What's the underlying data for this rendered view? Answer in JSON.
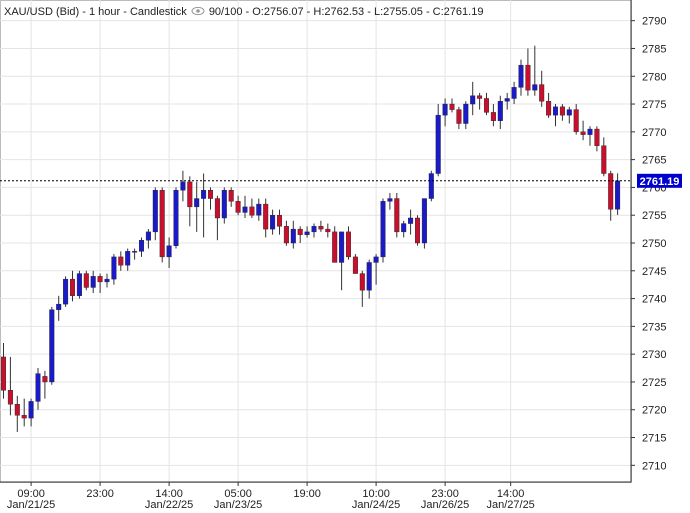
{
  "header": {
    "symbol": "XAU/USD (Bid)",
    "sep1": " - ",
    "interval": "1 hour",
    "sep2": " - ",
    "style": "Candlestick",
    "count": "90/100",
    "open": "O:2756.07",
    "high": "H:2762.53",
    "low": "L:2755.05",
    "close": "C:2761.19"
  },
  "colors": {
    "up": "#1a1ac8",
    "down": "#c8102e",
    "grid": "#e4e4e4",
    "axis": "#333333",
    "price_tag": "#0000cc"
  },
  "icons": {
    "visibility": "eye-icon"
  },
  "chart_data": {
    "type": "candlestick",
    "title": "XAU/USD (Bid) - 1 hour - Candlestick",
    "ylim": [
      2707,
      2793
    ],
    "yticks": [
      2710,
      2715,
      2720,
      2725,
      2730,
      2735,
      2740,
      2745,
      2750,
      2755,
      2760,
      2765,
      2770,
      2775,
      2780,
      2785,
      2790
    ],
    "grid": true,
    "current_price": 2761.19,
    "current_price_label": "2761.19",
    "xticks": [
      {
        "i": 4,
        "label": "09:00",
        "date": "Jan/21/25"
      },
      {
        "i": 14,
        "label": "23:00",
        "date": ""
      },
      {
        "i": 24,
        "label": "14:00",
        "date": "Jan/22/25"
      },
      {
        "i": 34,
        "label": "05:00",
        "date": "Jan/23/25"
      },
      {
        "i": 44,
        "label": "19:00",
        "date": ""
      },
      {
        "i": 54,
        "label": "10:00",
        "date": "Jan/24/25"
      },
      {
        "i": 64,
        "label": "23:00",
        "date": "Jan/26/25"
      },
      {
        "i": 73.5,
        "label": "14:00",
        "date": "Jan/27/25"
      }
    ],
    "ohlc": [
      [
        2729.5,
        2732,
        2722,
        2723.5
      ],
      [
        2723.5,
        2729.5,
        2719,
        2721
      ],
      [
        2721,
        2722.5,
        2716,
        2719
      ],
      [
        2719,
        2722,
        2717,
        2718.5
      ],
      [
        2718.5,
        2722,
        2717,
        2721.5
      ],
      [
        2721.5,
        2727.5,
        2720,
        2726.5
      ],
      [
        2726,
        2727,
        2722,
        2725
      ],
      [
        2725,
        2738.5,
        2724.5,
        2738
      ],
      [
        2738,
        2740.5,
        2736,
        2739
      ],
      [
        2739,
        2744,
        2738.5,
        2743.5
      ],
      [
        2743.5,
        2745,
        2739.5,
        2740.5
      ],
      [
        2740.5,
        2745,
        2740,
        2744.5
      ],
      [
        2744.5,
        2745,
        2741.5,
        2742
      ],
      [
        2742,
        2745,
        2741,
        2744
      ],
      [
        2744,
        2744.5,
        2741,
        2743
      ],
      [
        2743,
        2744.5,
        2742,
        2743.5
      ],
      [
        2743.5,
        2748,
        2742.5,
        2747.5
      ],
      [
        2747.5,
        2748.5,
        2745,
        2746
      ],
      [
        2746,
        2749,
        2745,
        2748.5
      ],
      [
        2748.5,
        2749,
        2747,
        2748.5
      ],
      [
        2748.5,
        2751,
        2747.5,
        2750.5
      ],
      [
        2750.5,
        2752.5,
        2749,
        2752
      ],
      [
        2752,
        2760,
        2750.5,
        2759.5
      ],
      [
        2759.5,
        2760,
        2746.5,
        2747.5
      ],
      [
        2747.5,
        2751,
        2745.5,
        2749.5
      ],
      [
        2749.5,
        2760,
        2749,
        2759.5
      ],
      [
        2759.5,
        2763,
        2757.5,
        2761
      ],
      [
        2761,
        2762,
        2753,
        2756.5
      ],
      [
        2756.5,
        2761,
        2752,
        2758
      ],
      [
        2758,
        2762.5,
        2751,
        2759.5
      ],
      [
        2759.5,
        2760,
        2756,
        2758
      ],
      [
        2758,
        2758.5,
        2750.5,
        2754.5
      ],
      [
        2754.5,
        2760,
        2753.5,
        2759.5
      ],
      [
        2759.5,
        2760,
        2756.5,
        2757.5
      ],
      [
        2757.5,
        2758.5,
        2755,
        2755.5
      ],
      [
        2755.5,
        2758.5,
        2754.5,
        2756.5
      ],
      [
        2756.5,
        2758,
        2754.5,
        2755
      ],
      [
        2755,
        2758,
        2754,
        2757
      ],
      [
        2757,
        2758,
        2751,
        2752.5
      ],
      [
        2752.5,
        2756,
        2751.5,
        2755
      ],
      [
        2755,
        2756,
        2751.5,
        2753
      ],
      [
        2753,
        2754,
        2749.5,
        2750
      ],
      [
        2750,
        2754,
        2749,
        2752.5
      ],
      [
        2752.5,
        2753,
        2750,
        2751.5
      ],
      [
        2751.5,
        2753,
        2751,
        2752
      ],
      [
        2752,
        2753.5,
        2751,
        2753
      ],
      [
        2753,
        2754,
        2752,
        2752.5
      ],
      [
        2752.5,
        2753.5,
        2751,
        2752
      ],
      [
        2752,
        2753,
        2746.5,
        2746.5
      ],
      [
        2746.5,
        2752,
        2741.5,
        2752
      ],
      [
        2752,
        2753,
        2747,
        2747.5
      ],
      [
        2747.5,
        2748,
        2744.5,
        2744.5
      ],
      [
        2744.5,
        2745,
        2738.5,
        2741.5
      ],
      [
        2741.5,
        2747,
        2740,
        2746.5
      ],
      [
        2746.5,
        2748,
        2742.5,
        2747.5
      ],
      [
        2747.5,
        2758,
        2746.5,
        2757.5
      ],
      [
        2757.5,
        2759,
        2756,
        2758
      ],
      [
        2758,
        2759,
        2751,
        2752
      ],
      [
        2752,
        2754,
        2751,
        2753.5
      ],
      [
        2753.5,
        2756,
        2751.5,
        2754.5
      ],
      [
        2754.5,
        2755,
        2749.5,
        2750
      ],
      [
        2750,
        2758,
        2749,
        2758
      ],
      [
        2758,
        2763,
        2757.5,
        2762.5
      ],
      [
        2762.5,
        2775,
        2762,
        2773
      ],
      [
        2773,
        2776,
        2771,
        2775
      ],
      [
        2775,
        2776,
        2773.5,
        2774
      ],
      [
        2774,
        2774.5,
        2770.5,
        2771.5
      ],
      [
        2771.5,
        2775.5,
        2770.5,
        2775
      ],
      [
        2775,
        2779,
        2773,
        2776.5
      ],
      [
        2776.5,
        2777,
        2774,
        2776
      ],
      [
        2776,
        2777,
        2773,
        2773.5
      ],
      [
        2773.5,
        2775,
        2771,
        2772
      ],
      [
        2772,
        2776.5,
        2770.5,
        2775.5
      ],
      [
        2775.5,
        2777,
        2774,
        2776
      ],
      [
        2776,
        2779,
        2775,
        2778
      ],
      [
        2778,
        2783,
        2776.5,
        2782
      ],
      [
        2782,
        2785,
        2776.5,
        2777.5
      ],
      [
        2777.5,
        2785.5,
        2776.5,
        2778.5
      ],
      [
        2778.5,
        2781,
        2774.5,
        2775.5
      ],
      [
        2775.5,
        2777,
        2772.5,
        2773
      ],
      [
        2773,
        2775,
        2771,
        2774.5
      ],
      [
        2774.5,
        2775,
        2772,
        2773
      ],
      [
        2773,
        2774.5,
        2771.5,
        2774
      ],
      [
        2774,
        2775,
        2769.5,
        2770
      ],
      [
        2770,
        2772,
        2768.5,
        2769.5
      ],
      [
        2769.5,
        2771,
        2767.5,
        2770.5
      ],
      [
        2770.5,
        2771,
        2766.5,
        2767.5
      ],
      [
        2767.5,
        2769,
        2762,
        2762.5
      ],
      [
        2762.5,
        2763,
        2754,
        2756.07
      ],
      [
        2756.07,
        2762.53,
        2755.05,
        2761.19
      ]
    ]
  }
}
